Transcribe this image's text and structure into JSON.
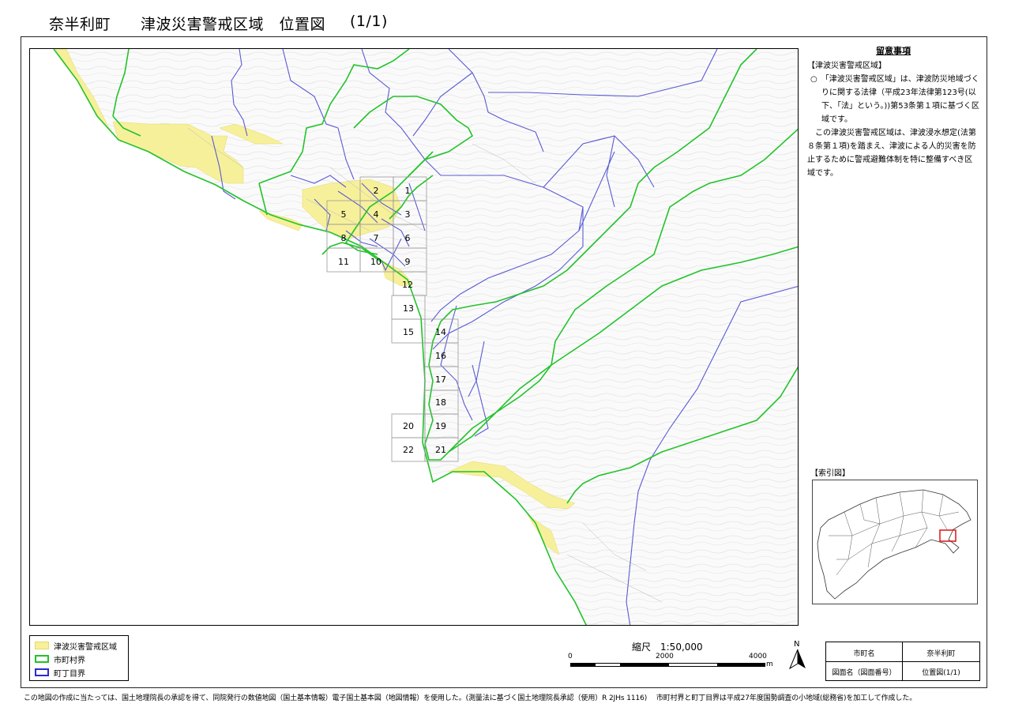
{
  "header": {
    "town": "奈半利町",
    "title": "津波災害警戒区域　位置図",
    "page": "(1/1)"
  },
  "notes": {
    "heading": "留意事項",
    "section": "【津波災害警戒区域】",
    "line1": "○　「津波災害警戒区域」は、津波防災地域づくりに関する法律（平成23年法律第123号(以下、「法」という。))第53条第１項に基づく区域です。",
    "line2": "この津波災害警戒区域は、津波浸水想定(法第８条第１項)を踏まえ、津波による人的災害を防止するために警戒避難体制を特に整備すべき区域です。"
  },
  "index_map": {
    "label": "【索引図】"
  },
  "map": {
    "tiles": [
      "1",
      "2",
      "3",
      "4",
      "5",
      "6",
      "7",
      "8",
      "9",
      "10",
      "11",
      "12",
      "13",
      "14",
      "15",
      "16",
      "17",
      "18",
      "19",
      "20",
      "21",
      "22"
    ],
    "colors": {
      "zone": "#f7f09a",
      "city_boundary": "#22c32a",
      "town_boundary": "#5a5ad6",
      "index_highlight": "#e01010"
    }
  },
  "legend": {
    "items": [
      {
        "label": "津波災害警戒区域"
      },
      {
        "label": "市町村界"
      },
      {
        "label": "町丁目界"
      }
    ]
  },
  "scale": {
    "title": "縮尺　1:50,000",
    "ticks": [
      "0",
      "2000",
      "4000"
    ],
    "unit": "m"
  },
  "north": {
    "label": "N"
  },
  "info": {
    "town_header": "市町名",
    "town_value": "奈半利町",
    "sheet_header": "図面名（図面番号）",
    "sheet_value": "位置図(1/1)"
  },
  "footer": {
    "text": "この地図の作成に当たっては、国土地理院長の承認を得て、同院発行の数値地図（国土基本情報）電子国土基本図（地図情報）を使用した。(測量法に基づく国土地理院長承認（使用）R 2JHs 1116)　 市町村界と町丁目界は平成27年度国勢調査の小地域(総務省)を加工して作成した。"
  }
}
